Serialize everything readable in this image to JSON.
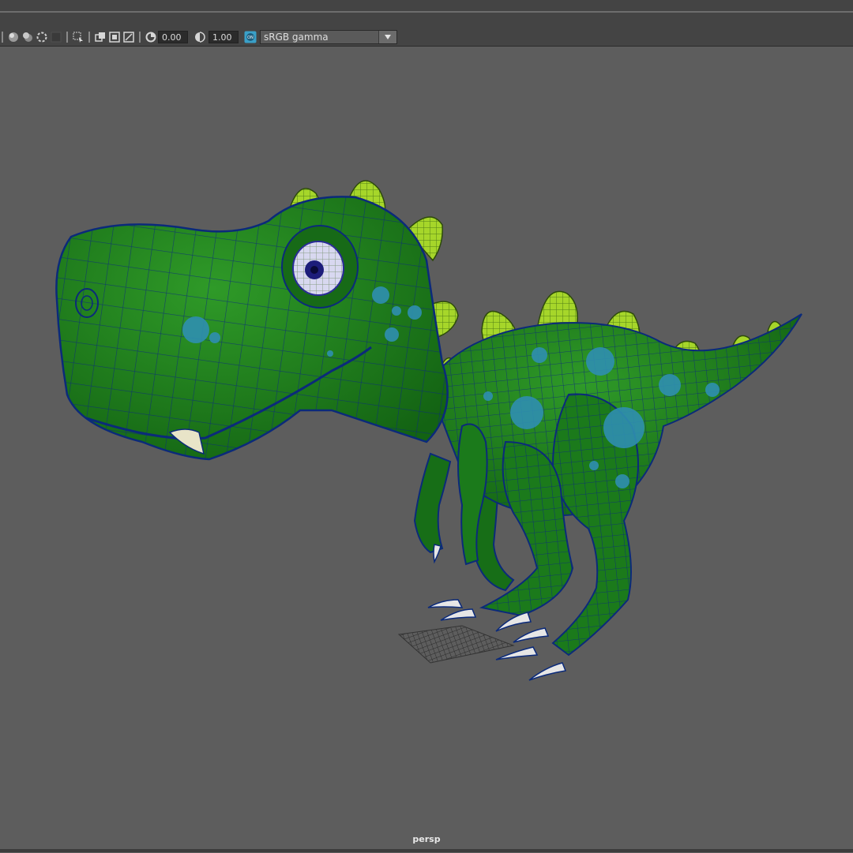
{
  "toolbar": {
    "exposure_value": "0.00",
    "gamma_value": "1.00",
    "color_management_badge": "ON",
    "color_space_label": "sRGB gamma"
  },
  "viewport": {
    "camera_label": "persp"
  },
  "colors": {
    "background": "#5d5d5d",
    "toolbar": "#444444",
    "body_green": "#1e7a1e",
    "spike_green": "#a6d62a",
    "spot_blue": "#2f8fb0",
    "wire": "#0b2a7a"
  },
  "icons": [
    "shaded-sphere-icon",
    "wire-sphere-icon",
    "isolate-icon",
    "resolution-gate-icon",
    "select-camera-icon",
    "film-gate-icon",
    "safe-frame-icon",
    "grid-frame-icon",
    "exposure-icon",
    "gamma-icon",
    "color-management-icon"
  ]
}
